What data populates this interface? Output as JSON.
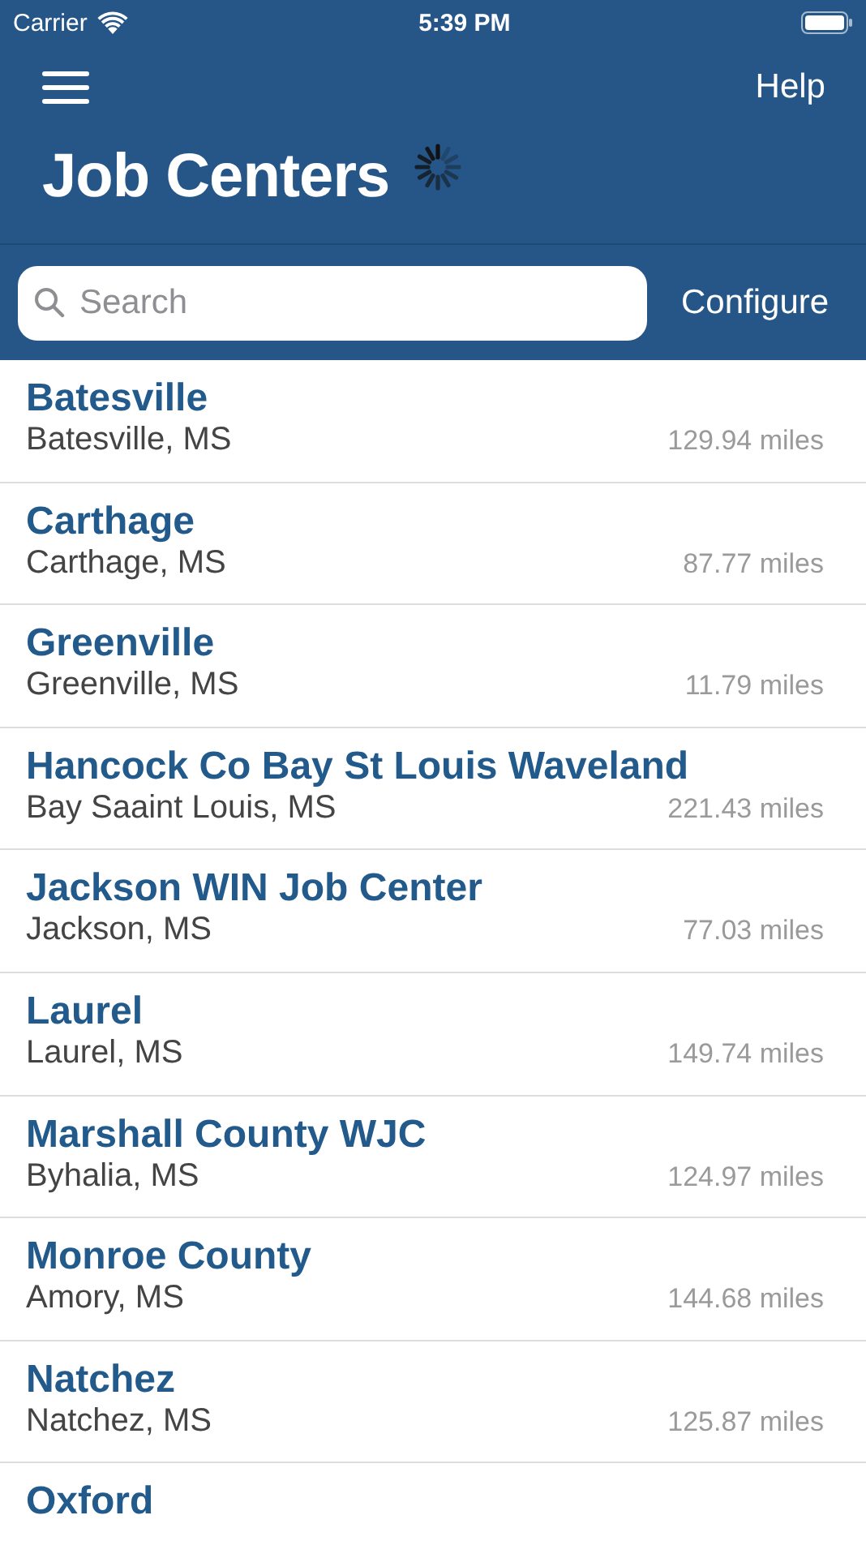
{
  "status_bar": {
    "carrier": "Carrier",
    "time": "5:39 PM"
  },
  "nav": {
    "help": "Help",
    "title": "Job Centers",
    "loading": true
  },
  "search": {
    "placeholder": "Search",
    "configure": "Configure"
  },
  "centers": [
    {
      "name": "Batesville",
      "location": "Batesville, MS",
      "distance": "129.94 miles"
    },
    {
      "name": "Carthage",
      "location": "Carthage, MS",
      "distance": "87.77 miles"
    },
    {
      "name": "Greenville",
      "location": "Greenville, MS",
      "distance": "11.79 miles"
    },
    {
      "name": "Hancock Co Bay St Louis Waveland",
      "location": "Bay Saaint Louis, MS",
      "distance": "221.43 miles"
    },
    {
      "name": "Jackson WIN Job Center",
      "location": "Jackson, MS",
      "distance": "77.03 miles"
    },
    {
      "name": "Laurel",
      "location": "Laurel, MS",
      "distance": "149.74 miles"
    },
    {
      "name": "Marshall County WJC",
      "location": "Byhalia, MS",
      "distance": "124.97 miles"
    },
    {
      "name": "Monroe County",
      "location": "Amory, MS",
      "distance": "144.68 miles"
    },
    {
      "name": "Natchez",
      "location": "Natchez, MS",
      "distance": "125.87 miles"
    },
    {
      "name": "Oxford"
    }
  ]
}
